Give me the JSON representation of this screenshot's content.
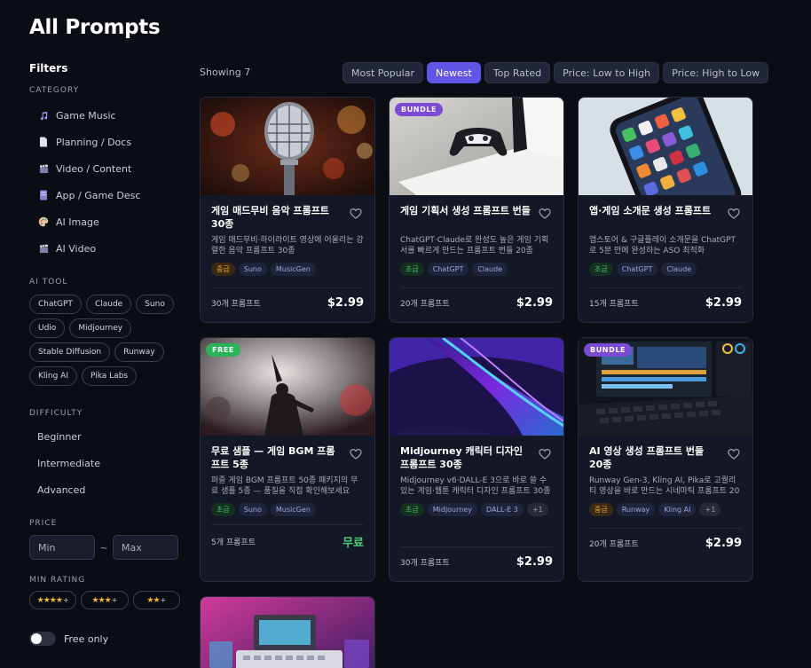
{
  "page": {
    "title": "All Prompts"
  },
  "sidebar": {
    "filters_title": "Filters",
    "category_label": "CATEGORY",
    "categories": [
      {
        "label": "Game Music",
        "icon": "music-note-icon"
      },
      {
        "label": "Planning / Docs",
        "icon": "document-icon"
      },
      {
        "label": "Video / Content",
        "icon": "clapperboard-icon"
      },
      {
        "label": "App / Game Desc",
        "icon": "book-icon"
      },
      {
        "label": "AI Image",
        "icon": "palette-icon"
      },
      {
        "label": "AI Video",
        "icon": "clapperboard-icon"
      }
    ],
    "aitool_label": "AI TOOL",
    "tools": [
      "ChatGPT",
      "Claude",
      "Suno",
      "Udio",
      "Midjourney",
      "Stable Diffusion",
      "Runway",
      "Kling AI",
      "Pika Labs"
    ],
    "difficulty_label": "DIFFICULTY",
    "difficulties": [
      "Beginner",
      "Intermediate",
      "Advanced"
    ],
    "price_label": "PRICE",
    "price_min_placeholder": "Min",
    "price_separator": "~",
    "price_max_placeholder": "Max",
    "min_rating_label": "MIN RATING",
    "ratings": [
      {
        "stars": "★★★★",
        "plus": "+"
      },
      {
        "stars": "★★★",
        "plus": "+"
      },
      {
        "stars": "★★",
        "plus": "+"
      }
    ],
    "free_only_label": "Free only",
    "free_only_on": false
  },
  "toolbar": {
    "showing": "Showing 7",
    "sorts": [
      "Most Popular",
      "Newest",
      "Top Rated",
      "Price: Low to High",
      "Price: High to Low"
    ],
    "active_sort": "Newest"
  },
  "cards": [
    {
      "badge": "",
      "title": "게임 매드무비 음악 프롬프트 30종",
      "desc": "게임 매드무비·하이라이트 영상에 어울리는 강렬한 음악 프롬프트 30종",
      "tags": [
        {
          "label": "중급",
          "kind": "lvl-int"
        },
        {
          "label": "Suno",
          "kind": "tool"
        },
        {
          "label": "MusicGen",
          "kind": "tool"
        }
      ],
      "count": "30개 프롬프트",
      "price": "$2.99"
    },
    {
      "badge": "BUNDLE",
      "title": "게임 기획서 생성 프롬프트 번들",
      "desc": "ChatGPT·Claude로 완성도 높은 게임 기획서를 빠르게 만드는 프롬프트 번들 20종",
      "tags": [
        {
          "label": "초급",
          "kind": "lvl-beg"
        },
        {
          "label": "ChatGPT",
          "kind": "tool"
        },
        {
          "label": "Claude",
          "kind": "tool"
        }
      ],
      "count": "20개 프롬프트",
      "price": "$2.99"
    },
    {
      "badge": "",
      "title": "앱·게임 소개문 생성 프롬프트",
      "desc": "앱스토어 & 구글플레이 소개문을 ChatGPT로 5분 만에 완성하는 ASO 최적화",
      "tags": [
        {
          "label": "초급",
          "kind": "lvl-beg"
        },
        {
          "label": "ChatGPT",
          "kind": "tool"
        },
        {
          "label": "Claude",
          "kind": "tool"
        }
      ],
      "count": "15개 프롬프트",
      "price": "$2.99"
    },
    {
      "badge": "FREE",
      "title": "무료 샘플 — 게임 BGM 프롬프트 5종",
      "desc": "퍼즐 게임 BGM 프롬프트 50종 패키지의 무료 샘플 5종 — 품질을 직접 확인해보세요",
      "tags": [
        {
          "label": "초급",
          "kind": "lvl-beg"
        },
        {
          "label": "Suno",
          "kind": "tool"
        },
        {
          "label": "MusicGen",
          "kind": "tool"
        }
      ],
      "count": "5개 프롬프트",
      "price": "무료",
      "price_free": true
    },
    {
      "badge": "",
      "title": "Midjourney 캐릭터 디자인 프롬프트 30종",
      "desc": "Midjourney v6·DALL-E 3으로 바로 쓸 수 있는 게임·웹툰 캐릭터 디자인 프롬프트 30종",
      "tags": [
        {
          "label": "초급",
          "kind": "lvl-beg"
        },
        {
          "label": "Midjourney",
          "kind": "tool"
        },
        {
          "label": "DALL-E 3",
          "kind": "tool"
        },
        {
          "label": "+1",
          "kind": "more"
        }
      ],
      "count": "30개 프롬프트",
      "price": "$2.99"
    },
    {
      "badge": "BUNDLE",
      "title": "AI 영상 생성 프롬프트 번들 20종",
      "desc": "Runway Gen-3, Kling AI, Pika로 고퀄리티 영상을 바로 만드는 시네마틱 프롬프트 20종",
      "tags": [
        {
          "label": "중급",
          "kind": "lvl-int"
        },
        {
          "label": "Runway",
          "kind": "tool"
        },
        {
          "label": "Kling AI",
          "kind": "tool"
        },
        {
          "label": "+1",
          "kind": "more"
        }
      ],
      "count": "20개 프롬프트",
      "price": "$2.99"
    },
    {
      "badge": "",
      "title": "",
      "desc": "",
      "tags": [],
      "count": "",
      "price": ""
    }
  ]
}
